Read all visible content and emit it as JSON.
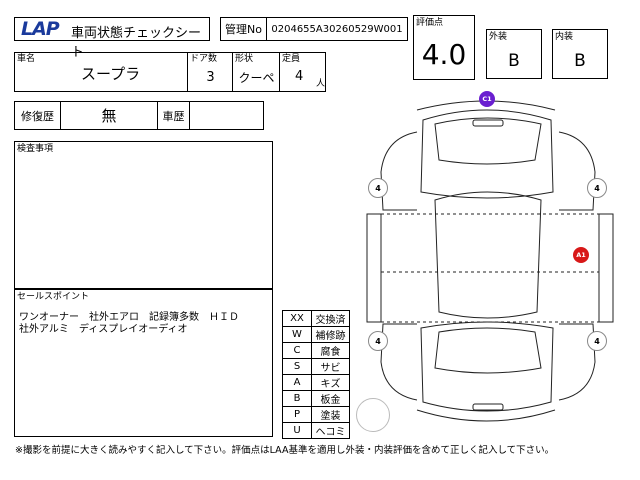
{
  "header": {
    "logo_text": "LAP",
    "sheet_title": "車両状態チェックシート",
    "management_label": "管理No",
    "management_no": "0204655A30260529W001"
  },
  "grades": {
    "overall_label": "評価点",
    "overall_value": "4.0",
    "exterior_label": "外装",
    "exterior_value": "B",
    "interior_label": "内装",
    "interior_value": "B"
  },
  "vehicle": {
    "name_label": "車名",
    "name_value": "スープラ",
    "doors_label": "ドア数",
    "doors_value": "3",
    "body_label": "形状",
    "body_value": "クーペ",
    "capacity_label": "定員",
    "capacity_value": "4",
    "capacity_unit": "人"
  },
  "history": {
    "repair_label": "修復歴",
    "repair_value": "無",
    "car_history_label": "車歴",
    "car_history_value": ""
  },
  "inspection": {
    "label": "検査事項",
    "content": ""
  },
  "selling_points": {
    "label": "セールスポイント",
    "line1": "ワンオーナー　社外エアロ　記録簿多数　ＨＩＤ",
    "line2": "社外アルミ　ディスプレイオーディオ"
  },
  "legend": [
    {
      "code": "XX",
      "meaning": "交換済"
    },
    {
      "code": "W",
      "meaning": "補修跡"
    },
    {
      "code": "C",
      "meaning": "腐食"
    },
    {
      "code": "S",
      "meaning": "サビ"
    },
    {
      "code": "A",
      "meaning": "キズ"
    },
    {
      "code": "B",
      "meaning": "板金"
    },
    {
      "code": "P",
      "meaning": "塗装"
    },
    {
      "code": "U",
      "meaning": "ヘコミ"
    }
  ],
  "diagram": {
    "tire_tread": [
      "4",
      "4",
      "4",
      "4"
    ],
    "damage_markers": [
      {
        "code": "C1",
        "color": "#6a1fd0"
      },
      {
        "code": "A1",
        "color": "#d81818"
      }
    ]
  },
  "footer_note": "※撮影を前提に大きく読みやすく記入して下さい。評価点はLAA基準を適用し外装・内装評価を含めて正しく記入して下さい。"
}
